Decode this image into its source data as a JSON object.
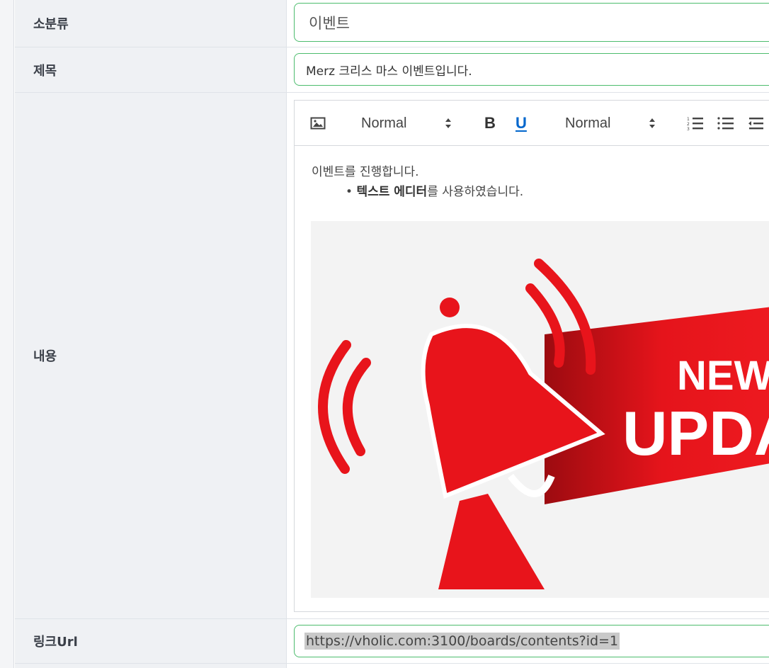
{
  "form": {
    "subcategory": {
      "label": "소분류",
      "value": "이벤트"
    },
    "title": {
      "label": "제목",
      "value": "Merz 크리스 마스 이벤트입니다."
    },
    "content": {
      "label": "내용",
      "toolbar": {
        "header_select": "Normal",
        "size_select": "Normal",
        "bold_label": "B",
        "underline_label": "U"
      },
      "paragraph": "이벤트를 진행합니다.",
      "bullet": {
        "bold_text": "텍스트 에디터",
        "rest_text": "를 사용하였습니다."
      },
      "image": {
        "banner_line1": "NEW",
        "banner_line2": "UPDA"
      }
    },
    "link": {
      "label": "링크Url",
      "value": "https://vholic.com:3100/boards/contents?id=1"
    }
  },
  "colors": {
    "accent_border": "#4cbc6d",
    "label_bg": "#eff1f4",
    "image_red": "#e8141b",
    "link_selection": "#c9c9c9"
  },
  "icons": [
    "image-icon",
    "caret-updown-icon",
    "ordered-list-icon",
    "bullet-list-icon",
    "outdent-icon"
  ]
}
